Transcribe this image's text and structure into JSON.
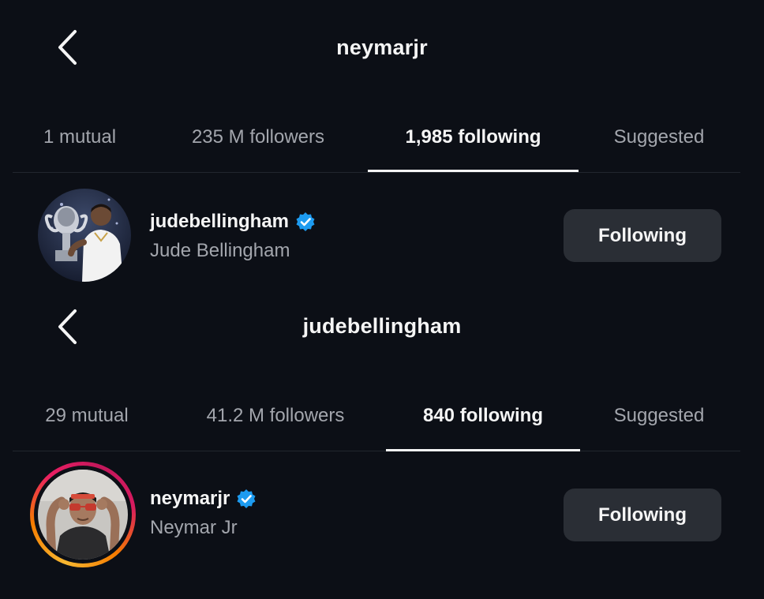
{
  "screens": [
    {
      "title": "neymarjr",
      "tabs": [
        "1 mutual",
        "235 M followers",
        "1,985 following",
        "Suggested"
      ],
      "active_tab": "1,985 following",
      "user": {
        "username": "judebellingham",
        "full_name": "Jude Bellingham",
        "verified": true,
        "follow_label": "Following"
      }
    },
    {
      "title": "judebellingham",
      "tabs": [
        "29 mutual",
        "41.2 M followers",
        "840 following",
        "Suggested"
      ],
      "active_tab": "840 following",
      "user": {
        "username": "neymarjr",
        "full_name": "Neymar Jr",
        "verified": true,
        "has_story_ring": true,
        "follow_label": "Following"
      }
    }
  ],
  "icons": {
    "back": "chevron-left-icon",
    "verified": "verified-badge-icon"
  },
  "colors": {
    "background": "#0c0f16",
    "verified_blue": "#1d9bf0",
    "button_bg": "#2a2e35",
    "secondary_text": "#a3a6ad"
  }
}
